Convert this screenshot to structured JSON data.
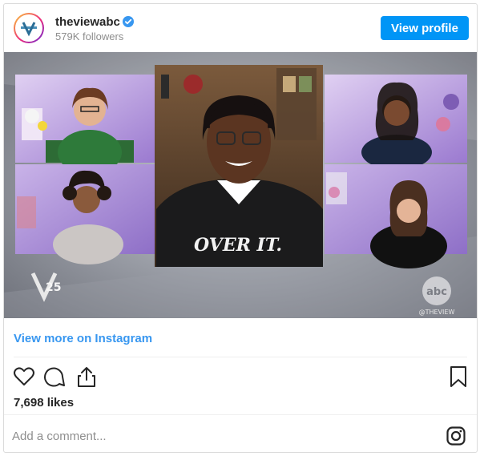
{
  "header": {
    "username": "theviewabc",
    "followers": "579K followers",
    "view_profile_label": "View profile"
  },
  "media": {
    "logo_text": "V",
    "shirt_text": "OVER IT.",
    "network_logo": "abc",
    "handle": "@THEVIEW"
  },
  "links": {
    "view_more": "View more on Instagram"
  },
  "actions": {
    "icons": [
      "heart-icon",
      "comment-icon",
      "share-icon",
      "bookmark-icon"
    ]
  },
  "likes": "7,698 likes",
  "comment": {
    "placeholder": "Add a comment..."
  },
  "colors": {
    "accent": "#0095f6",
    "link": "#3897f0",
    "text": "#262626",
    "muted": "#8e8e8e"
  }
}
